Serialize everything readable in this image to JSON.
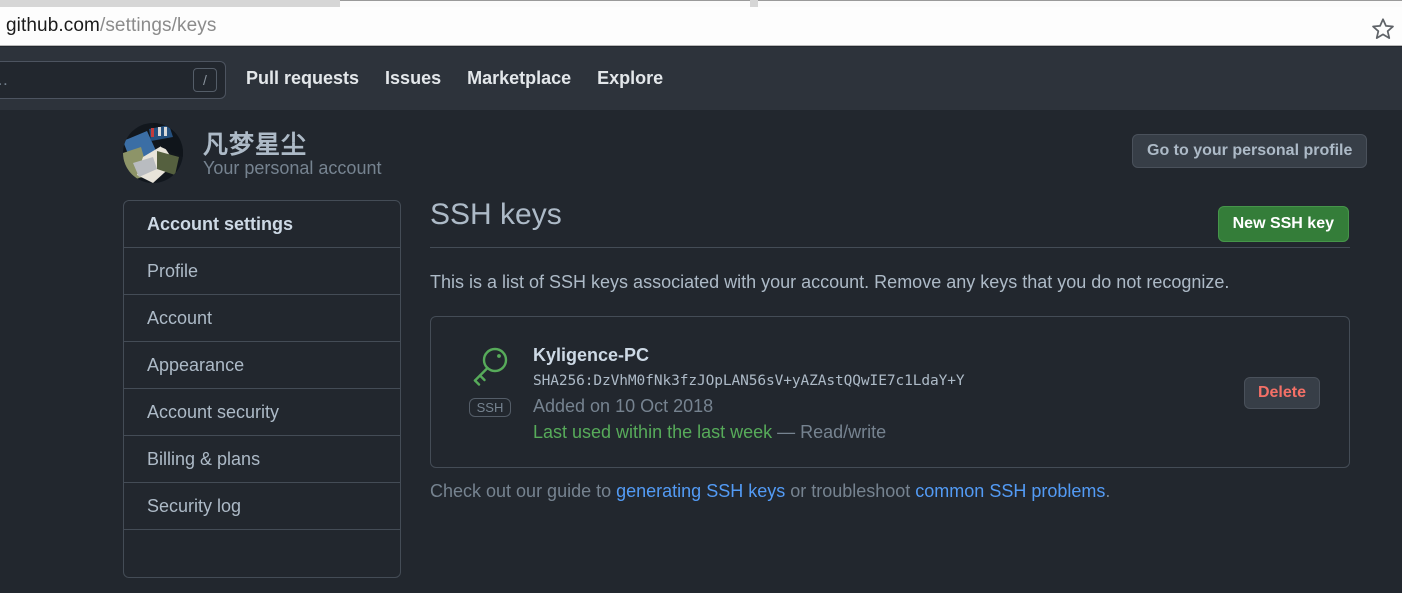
{
  "browser": {
    "url_host": "github.com",
    "url_path": "/settings/keys",
    "bookmark_icon": "star-icon"
  },
  "header": {
    "search_placeholder": "Search or jump to…",
    "search_visible_text": "mp to…",
    "search_shortcut": "/",
    "nav": [
      {
        "label": "Pull requests"
      },
      {
        "label": "Issues"
      },
      {
        "label": "Marketplace"
      },
      {
        "label": "Explore"
      }
    ]
  },
  "account": {
    "name": "凡梦星尘",
    "subtitle": "Your personal account",
    "profile_button": "Go to your personal profile",
    "avatar_icon": "user-avatar"
  },
  "sidebar": {
    "items": [
      {
        "label": "Account settings",
        "is_header": true
      },
      {
        "label": "Profile",
        "is_header": false
      },
      {
        "label": "Account",
        "is_header": false
      },
      {
        "label": "Appearance",
        "is_header": false
      },
      {
        "label": "Account security",
        "is_header": false
      },
      {
        "label": "Billing & plans",
        "is_header": false
      },
      {
        "label": "Security log",
        "is_header": false
      },
      {
        "label": "",
        "is_header": false
      }
    ]
  },
  "main": {
    "title": "SSH keys",
    "new_key_button": "New SSH key",
    "intro": "This is a list of SSH keys associated with your account. Remove any keys that you do not recognize.",
    "key": {
      "icon": "key-icon",
      "badge": "SSH",
      "title": "Kyligence-PC",
      "fingerprint": "SHA256:DzVhM0fNk3fzJOpLAN56sV+yAZAstQQwIE7c1LdaY+Y",
      "added": "Added on 10 Oct 2018",
      "last_used": "Last used within the last week",
      "permission": " — Read/write",
      "delete_button": "Delete"
    },
    "footer": {
      "prefix": "Check out our guide to ",
      "link1": "generating SSH keys",
      "middle": " or troubleshoot ",
      "link2": "common SSH problems",
      "suffix": "."
    }
  },
  "colors": {
    "page_bg": "#22272e",
    "header_bg": "#2d333b",
    "border": "#444c56",
    "text": "#adbac7",
    "muted": "#768390",
    "green": "#347d39",
    "green_text": "#57ab5a",
    "red": "#f47067",
    "link": "#539bf5"
  }
}
